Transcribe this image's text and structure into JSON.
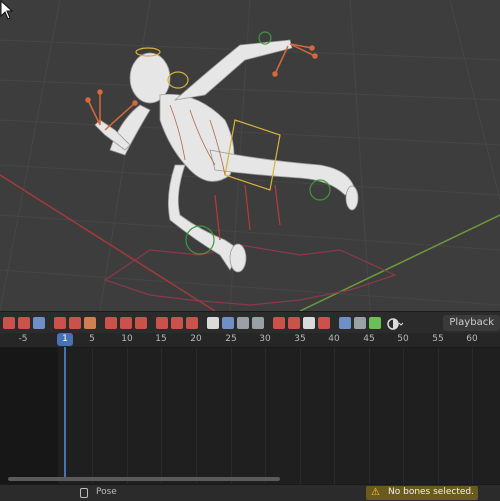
{
  "toolbar": {
    "playback_label": "Playback",
    "icons": [
      "keyframe-icon",
      "lock-icon",
      "snap-icon",
      "graph-icon",
      "bone-icon",
      "copy-icon",
      "paste-icon",
      "mirror-icon",
      "record-icon",
      "loc-icon",
      "rot-icon",
      "scale-icon",
      "bookmark-icon",
      "delete-icon",
      "filter-icon",
      "onion-icon",
      "bone-select-icon",
      "weight-icon",
      "xray-icon",
      "axis-icon",
      "paint-icon",
      "brush-icon",
      "sculpt-icon"
    ],
    "colors": {
      "accent_red": "#d74a4a",
      "accent_blue": "#5b8fd6",
      "accent_green": "#6bbf59"
    }
  },
  "timeline": {
    "current_frame": "1",
    "ticks": [
      "-5",
      "5",
      "10",
      "15",
      "20",
      "25",
      "30",
      "35",
      "40",
      "45",
      "50",
      "55",
      "60"
    ]
  },
  "statusbar": {
    "mode_label": "Pose",
    "warning_text": "No bones selected."
  }
}
